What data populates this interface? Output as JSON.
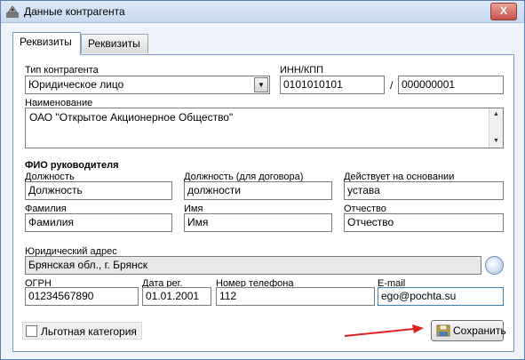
{
  "window": {
    "title": "Данные контрагента",
    "close_glyph": "X"
  },
  "tabs": [
    {
      "label": "Реквизиты",
      "active": true
    },
    {
      "label": "Реквизиты",
      "active": false
    }
  ],
  "form": {
    "contractor_type": {
      "label": "Тип контрагента",
      "value": "Юридическое лицо"
    },
    "inn_kpp": {
      "label": "ИНН/КПП",
      "inn": "0101010101",
      "separator": "/",
      "kpp": "000000001"
    },
    "name": {
      "label": "Наименование",
      "value": "ОАО \"Открытое Акционерное Общество\""
    },
    "head_section": "ФИО руководителя",
    "position": {
      "label": "Должность",
      "value": "Должность"
    },
    "position_contract": {
      "label": "Должность (для договора)",
      "value": "должности"
    },
    "acts_basis": {
      "label": "Действует на основании",
      "value": "устава"
    },
    "last_name": {
      "label": "Фамилия",
      "value": "Фамилия"
    },
    "first_name": {
      "label": "Имя",
      "value": "Имя"
    },
    "patronymic": {
      "label": "Отчество",
      "value": "Отчество"
    },
    "legal_address": {
      "label": "Юридический адрес",
      "value": "Брянская обл., г. Брянск"
    },
    "ogrn": {
      "label": "ОГРН",
      "value": "01234567890"
    },
    "reg_date": {
      "label": "Дата рег.",
      "value": "01.01.2001"
    },
    "phone": {
      "label": "Номер телефона",
      "value": "112"
    },
    "email": {
      "label": "E-mail",
      "value": "ego@pochta.su"
    },
    "preferential": {
      "label": "Льготная категория",
      "checked": false
    }
  },
  "actions": {
    "save_label": "Сохранить"
  },
  "icons": {
    "dropdown": "chevron-down-icon",
    "scroll_up": "scroll-up-icon",
    "scroll_down": "scroll-down-icon",
    "address_picker": "address-picker-icon",
    "save": "save-icon"
  },
  "colors": {
    "accent_arrow": "#e02020",
    "window_border": "#5a7fb0",
    "focus_border": "#3c7fb1"
  }
}
